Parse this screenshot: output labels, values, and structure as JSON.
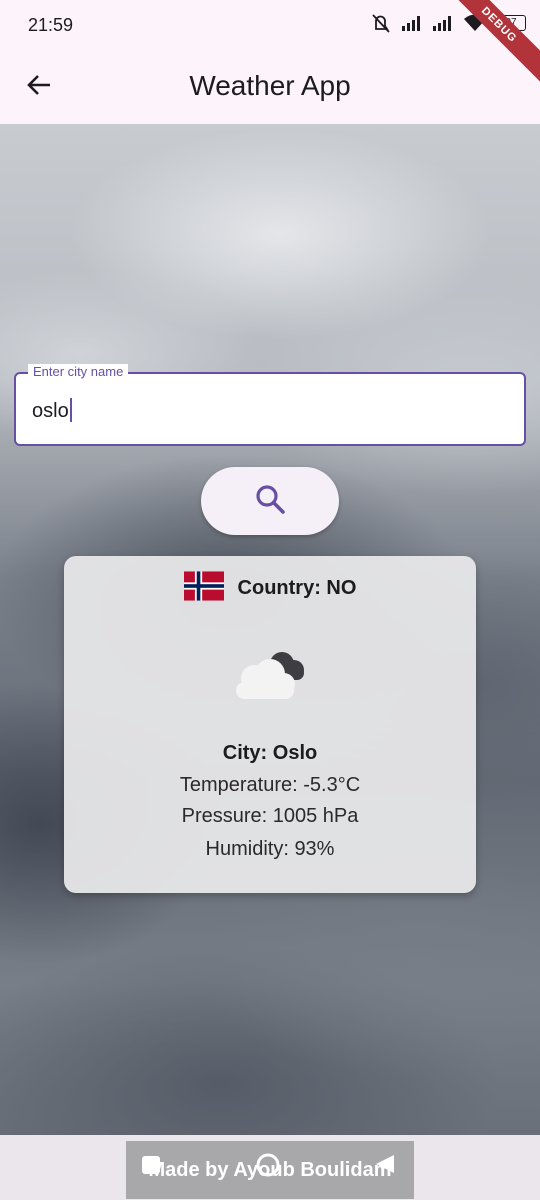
{
  "status_bar": {
    "time": "21:59",
    "battery": "97",
    "icons": [
      "mute-icon",
      "signal-icon",
      "signal-icon",
      "wifi-icon",
      "battery-icon"
    ]
  },
  "debug_banner": "DEBUG",
  "app_bar": {
    "title": "Weather App",
    "back_icon": "arrow-left-icon"
  },
  "search": {
    "label": "Enter city name",
    "value": "oslo",
    "button_icon": "search-icon"
  },
  "weather_card": {
    "country": "Country: NO",
    "flag_icon": "norway-flag-icon",
    "condition_icon": "cloud-icon",
    "city": "City: Oslo",
    "temperature": "Temperature: -5.3°C",
    "pressure": "Pressure: 1005 hPa",
    "humidity": "Humidity: 93%"
  },
  "footer": {
    "text": "Made by Ayoub Boulidam"
  },
  "nav_bar": {
    "icons": [
      "square-icon",
      "circle-icon",
      "triangle-back-icon"
    ]
  },
  "colors": {
    "accent": "#6750a4",
    "app_bar": "#fdf3fb",
    "card": "#e9e9eb"
  }
}
